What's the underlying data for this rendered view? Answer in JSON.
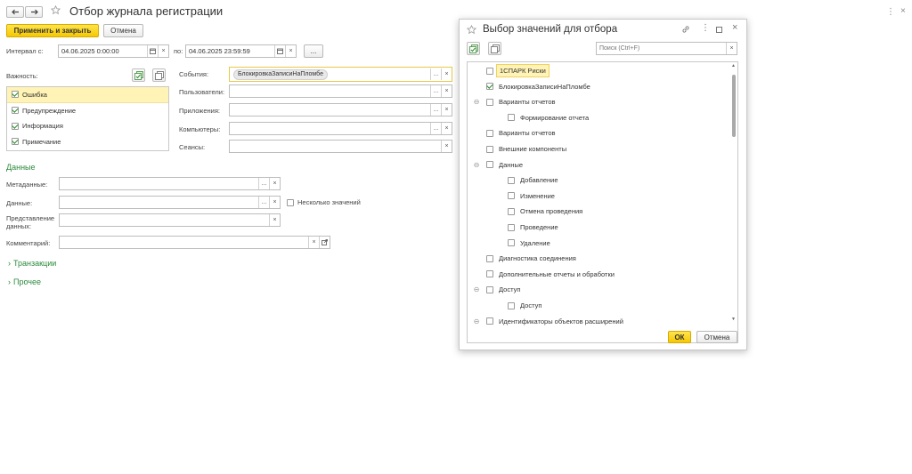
{
  "window": {
    "title": "Отбор журнала регистрации",
    "menu_icon": "more-vert-icon",
    "close_icon": "close-icon"
  },
  "toolbar": {
    "apply_label": "Применить и закрыть",
    "cancel_label": "Отмена"
  },
  "interval": {
    "from_label": "Интервал с:",
    "from_value": "04.06.2025  0:00:00",
    "to_label": "по:",
    "to_value": "04.06.2025 23:59:59",
    "more_label": "..."
  },
  "importance": {
    "label": "Важность:",
    "items": [
      {
        "label": "Ошибка",
        "checked": true
      },
      {
        "label": "Предупреждение",
        "checked": true
      },
      {
        "label": "Информация",
        "checked": true
      },
      {
        "label": "Примечание",
        "checked": true
      }
    ]
  },
  "filters": {
    "events_label": "События:",
    "events_value": "БлокировкаЗаписиНаПломбе",
    "users_label": "Пользователи:",
    "apps_label": "Приложения:",
    "computers_label": "Компьютеры:",
    "sessions_label": "Сеансы:"
  },
  "data_section": {
    "title": "Данные",
    "metadata_label": "Метаданные:",
    "data_label": "Данные:",
    "multi_label": "Несколько значений",
    "repr_label_1": "Представление",
    "repr_label_2": "данных:",
    "comment_label": "Комментарий:"
  },
  "transactions_title": "Транзакции",
  "other_title": "Прочее",
  "dialog": {
    "title": "Выбор значений для отбора",
    "search_placeholder": "Поиск (Ctrl+F)",
    "ok_label": "ОК",
    "cancel_label": "Отмена",
    "tree": [
      {
        "label": "1СПАРК Риски",
        "level": 0,
        "checked": false,
        "toggle": "",
        "highlighted": true
      },
      {
        "label": "БлокировкаЗаписиНаПломбе",
        "level": 0,
        "checked": true,
        "toggle": "",
        "highlighted": false
      },
      {
        "label": "Варианты отчетов",
        "level": 0,
        "checked": false,
        "toggle": "⊖",
        "highlighted": false
      },
      {
        "label": "Формирование отчета",
        "level": 1,
        "checked": false,
        "toggle": "",
        "highlighted": false
      },
      {
        "label": "Варианты отчетов",
        "level": 0,
        "checked": false,
        "toggle": "",
        "highlighted": false
      },
      {
        "label": "Внешние компоненты",
        "level": 0,
        "checked": false,
        "toggle": "",
        "highlighted": false
      },
      {
        "label": "Данные",
        "level": 0,
        "checked": false,
        "toggle": "⊖",
        "highlighted": false
      },
      {
        "label": "Добавление",
        "level": 1,
        "checked": false,
        "toggle": "",
        "highlighted": false
      },
      {
        "label": "Изменение",
        "level": 1,
        "checked": false,
        "toggle": "",
        "highlighted": false
      },
      {
        "label": "Отмена проведения",
        "level": 1,
        "checked": false,
        "toggle": "",
        "highlighted": false
      },
      {
        "label": "Проведение",
        "level": 1,
        "checked": false,
        "toggle": "",
        "highlighted": false
      },
      {
        "label": "Удаление",
        "level": 1,
        "checked": false,
        "toggle": "",
        "highlighted": false
      },
      {
        "label": "Диагностика соединения",
        "level": 0,
        "checked": false,
        "toggle": "",
        "highlighted": false
      },
      {
        "label": "Дополнительные отчеты и обработки",
        "level": 0,
        "checked": false,
        "toggle": "",
        "highlighted": false
      },
      {
        "label": "Доступ",
        "level": 0,
        "checked": false,
        "toggle": "⊖",
        "highlighted": false
      },
      {
        "label": "Доступ",
        "level": 1,
        "checked": false,
        "toggle": "",
        "highlighted": false
      },
      {
        "label": "Идентификаторы объектов расширений",
        "level": 0,
        "checked": false,
        "toggle": "⊖",
        "highlighted": false
      }
    ]
  }
}
